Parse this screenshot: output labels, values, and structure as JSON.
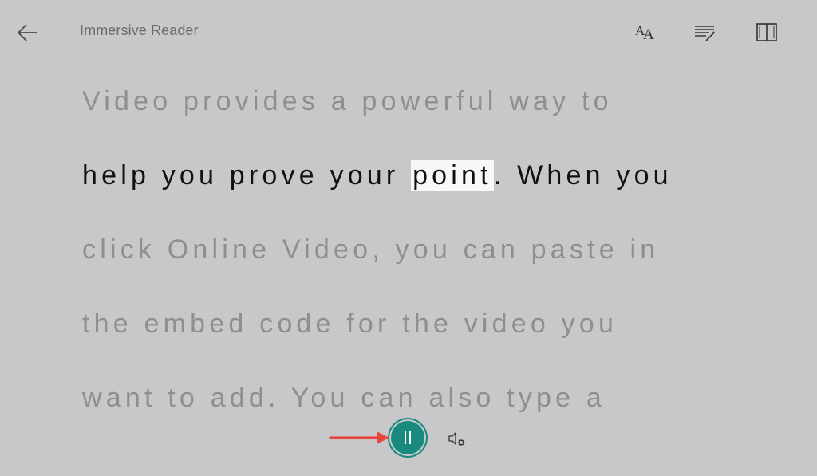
{
  "app": {
    "title": "Immersive Reader"
  },
  "toolbar": {
    "back_icon": "arrow-left-icon",
    "text_preferences_icon": "text-size-icon",
    "grammar_options_icon": "grammar-options-icon",
    "reading_preferences_icon": "book-icon"
  },
  "reader": {
    "lines": [
      "Video provides a powerful way to",
      "help you prove your ",
      "click Online Video, you can paste in",
      "the embed code for the video you",
      "want to add. You can also type a"
    ],
    "active_line_index": 1,
    "highlighted_word": "point",
    "after_highlight": ". When you"
  },
  "playback": {
    "state_icon": "pause-icon",
    "voice_settings_icon": "voice-settings-icon"
  },
  "colors": {
    "background": "#c8c8ca",
    "accent": "#1a8a7e",
    "annotation_arrow": "#e8473b",
    "inactive_text": "#8f8f8f",
    "active_text": "#111111",
    "highlight_bg": "#f8f8f8"
  }
}
